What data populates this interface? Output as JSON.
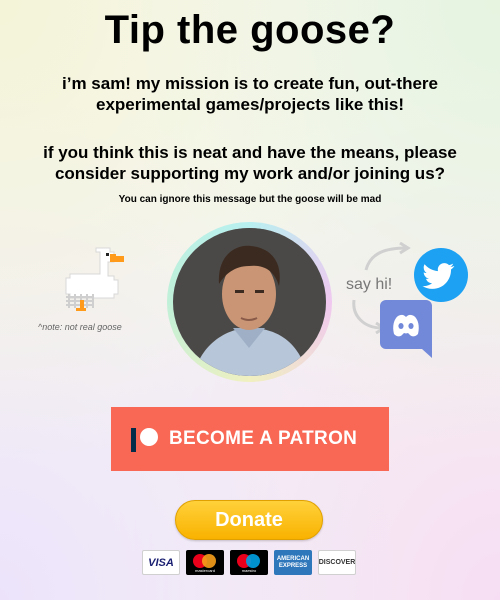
{
  "title": "Tip the goose?",
  "intro": "i’m sam! my mission is to create fun, out-there experimental games/projects like this!",
  "ask": "if you think this is neat and have the means, please consider supporting my work and/or joining us?",
  "ignore_note": "You can ignore this message but the goose will be mad",
  "goose_note": "^note: not real goose",
  "social": {
    "say_hi": "say hi!",
    "twitter_icon": "twitter-icon",
    "discord_icon": "discord-icon"
  },
  "patreon": {
    "label": "BECOME A PATRON",
    "color": "#f96854"
  },
  "donate": {
    "label": "Donate",
    "color": "#ffc72c"
  },
  "payment_cards": {
    "visa": "VISA",
    "mastercard": "mastercard",
    "maestro": "maestro",
    "amex_line1": "AMERICAN",
    "amex_line2": "EXPRESS",
    "discover": "DISCOVER"
  }
}
